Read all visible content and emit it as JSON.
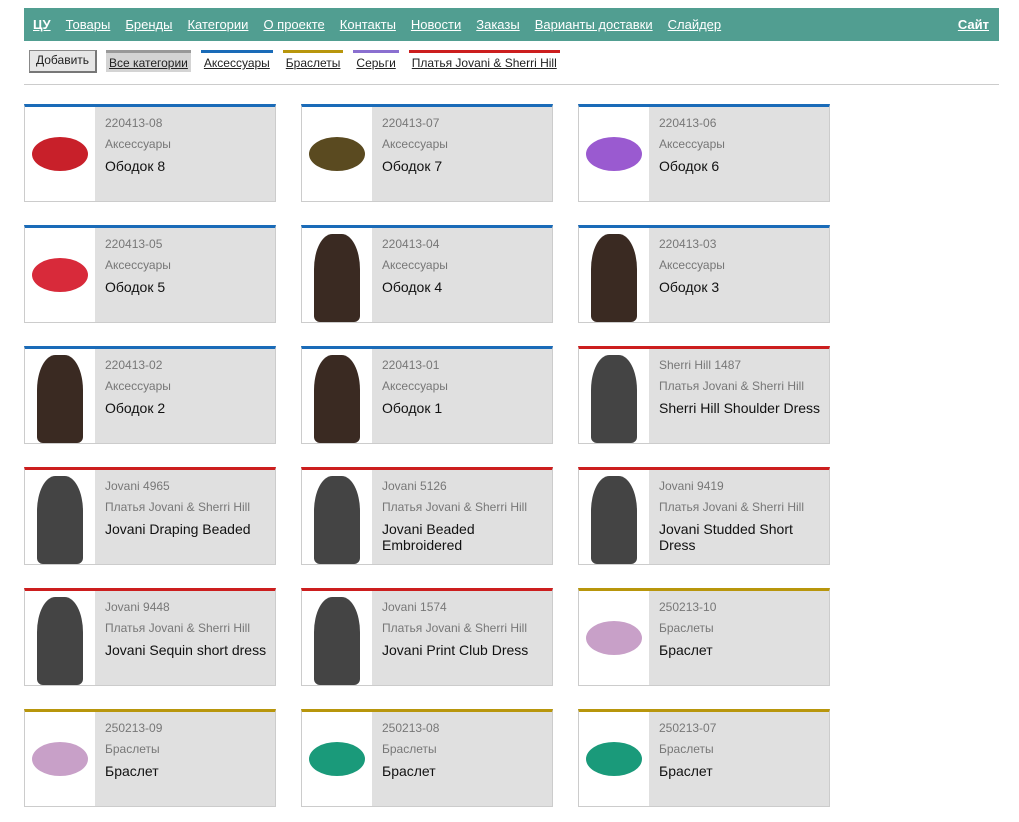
{
  "nav": {
    "home": "ЦУ",
    "items": [
      "Товары",
      "Бренды",
      "Категории",
      "О проекте",
      "Контакты",
      "Новости",
      "Заказы",
      "Варианты доставки",
      "Слайдер"
    ],
    "site": "Сайт"
  },
  "toolbar": {
    "add_label": "Добавить",
    "all_label": "Все категории"
  },
  "categories": [
    {
      "label": "Аксессуары",
      "color": "#1a6bb8"
    },
    {
      "label": "Браслеты",
      "color": "#b8960c"
    },
    {
      "label": "Серьги",
      "color": "#8a6fd0"
    },
    {
      "label": "Платья Jovani & Sherri Hill",
      "color": "#cc1e1e"
    }
  ],
  "products": [
    {
      "code": "220413-08",
      "cat": 0,
      "name": "Ободок 8",
      "img": "red-flower-headband"
    },
    {
      "code": "220413-07",
      "cat": 0,
      "name": "Ободок 7",
      "img": "dark-flower-headband"
    },
    {
      "code": "220413-06",
      "cat": 0,
      "name": "Ободок 6",
      "img": "purple-flower-headband"
    },
    {
      "code": "220413-05",
      "cat": 0,
      "name": "Ободок 5",
      "img": "red-rose-headband"
    },
    {
      "code": "220413-04",
      "cat": 0,
      "name": "Ободок 4",
      "img": "model-photo"
    },
    {
      "code": "220413-03",
      "cat": 0,
      "name": "Ободок 3",
      "img": "model-photo"
    },
    {
      "code": "220413-02",
      "cat": 0,
      "name": "Ободок 2",
      "img": "model-photo"
    },
    {
      "code": "220413-01",
      "cat": 0,
      "name": "Ободок 1",
      "img": "model-photo"
    },
    {
      "code": "Sherri Hill 1487",
      "cat": 3,
      "name": "Sherri Hill Shoulder Dress",
      "img": "dress-photo"
    },
    {
      "code": "Jovani 4965",
      "cat": 3,
      "name": "Jovani Draping Beaded",
      "img": "dress-photo"
    },
    {
      "code": "Jovani 5126",
      "cat": 3,
      "name": "Jovani Beaded Embroidered",
      "img": "dress-photo"
    },
    {
      "code": "Jovani 9419",
      "cat": 3,
      "name": "Jovani Studded Short Dress",
      "img": "dress-photo"
    },
    {
      "code": "Jovani 9448",
      "cat": 3,
      "name": "Jovani Sequin short dress",
      "img": "dress-photo"
    },
    {
      "code": "Jovani 1574",
      "cat": 3,
      "name": "Jovani Print Club Dress",
      "img": "dress-photo"
    },
    {
      "code": "250213-10",
      "cat": 1,
      "name": "Браслет",
      "img": "bracelet-photo"
    },
    {
      "code": "250213-09",
      "cat": 1,
      "name": "Браслет",
      "img": "bracelet-photo"
    },
    {
      "code": "250213-08",
      "cat": 1,
      "name": "Браслет",
      "img": "green-bracelet-photo"
    },
    {
      "code": "250213-07",
      "cat": 1,
      "name": "Браслет",
      "img": "green-bracelet-photo"
    }
  ]
}
